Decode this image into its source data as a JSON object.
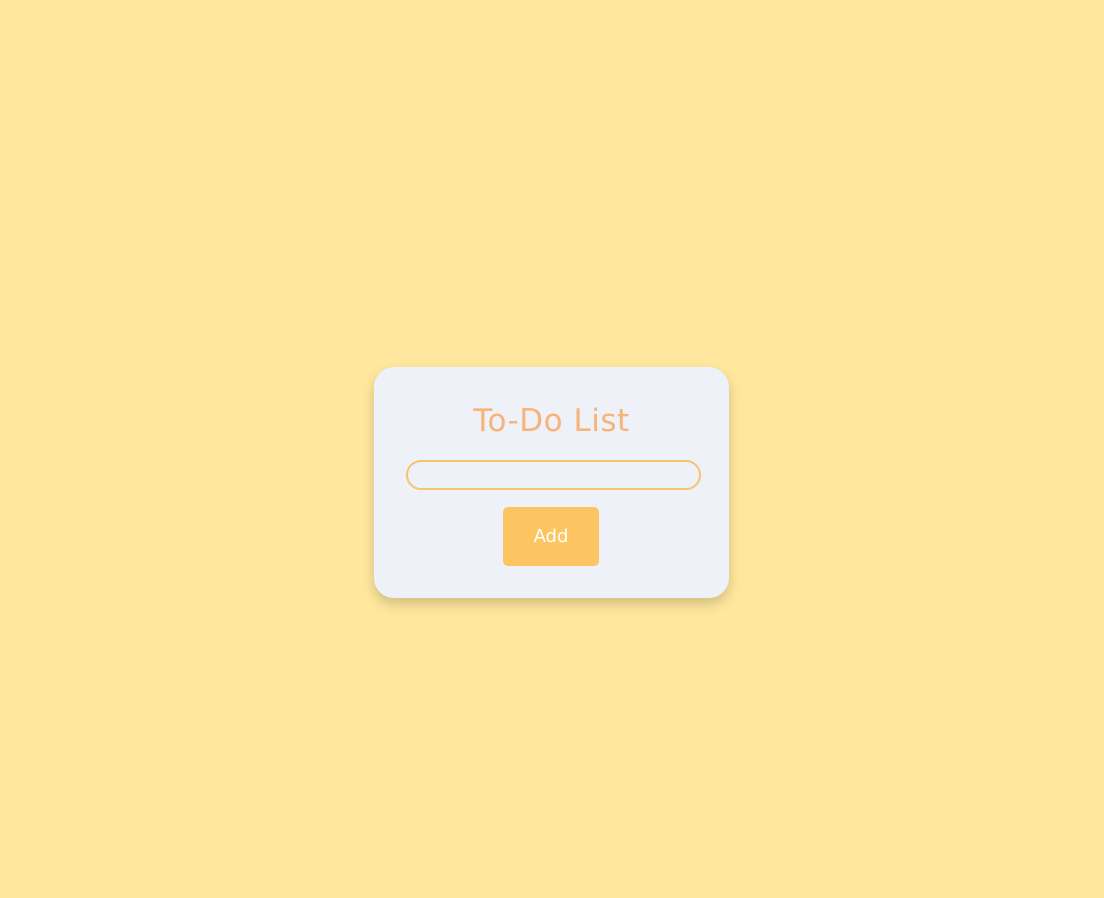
{
  "app": {
    "title": "To-Do List"
  },
  "task_input": {
    "value": "",
    "placeholder": ""
  },
  "add_button": {
    "label": "Add"
  },
  "colors": {
    "background": "#FFE79D",
    "card": "#EEF1F7",
    "title": "#F8B379",
    "input_border": "#F6C46A",
    "button": "#FCC562",
    "button_text": "#FFFFFF"
  }
}
